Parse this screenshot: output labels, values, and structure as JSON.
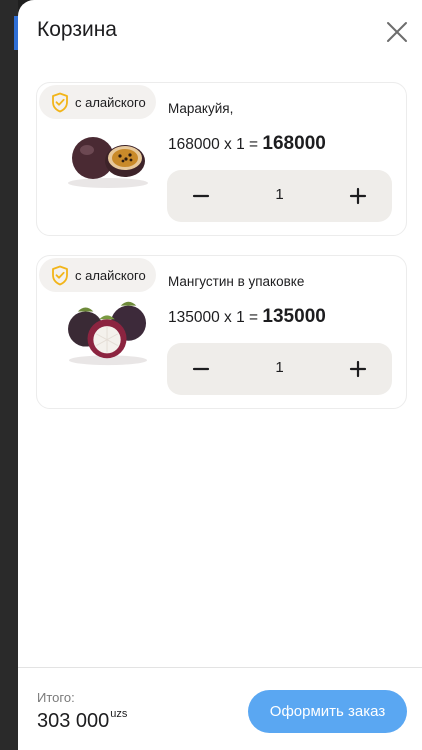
{
  "cart": {
    "title": "Корзина",
    "items": [
      {
        "badge": "с алайского",
        "name": "Маракуйя,",
        "price": "168000",
        "quantity": "1",
        "total": "168000",
        "image_icon": "passion-fruit-image"
      },
      {
        "badge": "с алайского",
        "name": "Мангустин в упаковке",
        "price": "135000",
        "quantity": "1",
        "total": "135000",
        "image_icon": "mangosteen-image"
      }
    ],
    "multiply_sign": "x",
    "equals_sign": "=",
    "footer": {
      "total_label": "Итого:",
      "total_amount": "303 000",
      "currency": "uzs",
      "order_button": "Оформить заказ"
    }
  },
  "colors": {
    "accent": "#5aa7f2",
    "badge_shield": "#f2b51a",
    "stepper_bg": "#efedea"
  }
}
